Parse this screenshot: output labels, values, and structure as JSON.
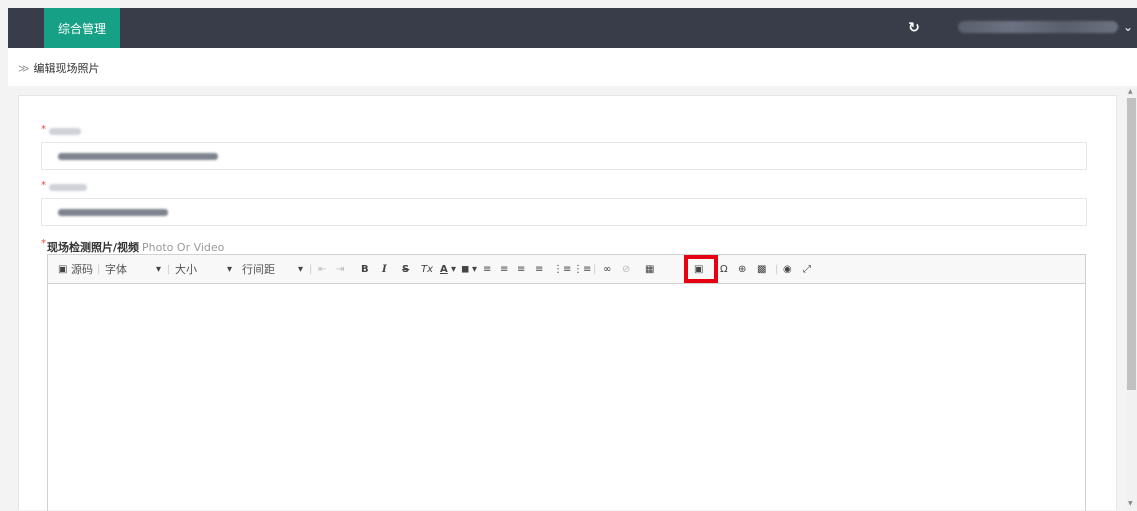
{
  "topbar": {
    "active_tab": "综合管理",
    "refresh_icon": "refresh-icon",
    "user_dropdown_icon": "chevron-down-icon",
    "colors": {
      "bar": "#393d49",
      "tab": "#16a085"
    }
  },
  "breadcrumb": {
    "arrow": "≫",
    "label": "编辑现场照片"
  },
  "form": {
    "media_label": "现场检测照片/视频",
    "media_label_en": "Photo Or Video",
    "required_mark": "*"
  },
  "toolbar": {
    "source": "源码",
    "font": "字体",
    "size": "大小",
    "line_height": "行间距",
    "caret": "▾",
    "sep": "|",
    "bold": "B",
    "italic": "I",
    "strike": "S",
    "remove_format": "Tx",
    "font_color": "A",
    "bg_color": "◼",
    "align_left": "≡",
    "align_center": "≡",
    "align_right": "≡",
    "justify": "≡",
    "ordered_list": "⋮≡",
    "bullet_list": "⋮≡",
    "link": "∞",
    "unlink": "⊘",
    "table": "▦",
    "image": "▣",
    "special_char": "Ω",
    "globe": "⊕",
    "qrcode": "▩",
    "preview": "◉",
    "fullscreen": "⤢",
    "outdent": "⇤",
    "indent": "⇥"
  },
  "highlight_color": "#e60012"
}
